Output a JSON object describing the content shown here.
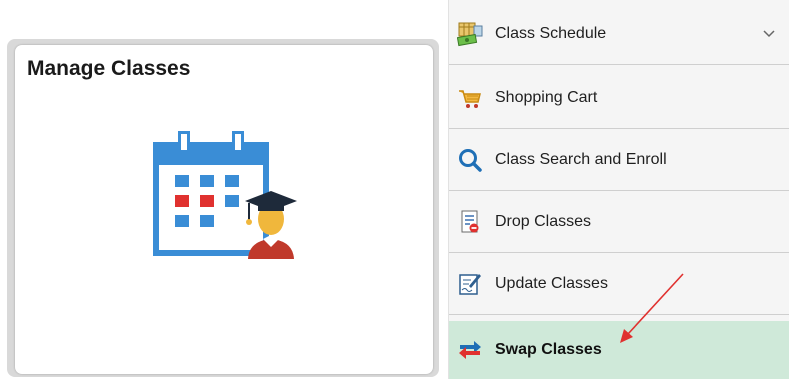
{
  "tile": {
    "title": "Manage Classes",
    "icon": "calendar-graduate-icon"
  },
  "menu": {
    "items": [
      {
        "label": "Class Schedule",
        "icon": "schedule-money-icon",
        "expanded": false
      },
      {
        "label": "Shopping Cart",
        "icon": "shopping-cart-icon"
      },
      {
        "label": "Class Search and Enroll",
        "icon": "search-icon"
      },
      {
        "label": "Drop Classes",
        "icon": "drop-document-icon"
      },
      {
        "label": "Update Classes",
        "icon": "edit-document-icon"
      },
      {
        "label": "Swap Classes",
        "icon": "swap-arrows-icon",
        "active": true
      }
    ]
  },
  "colors": {
    "active_bg": "#cfe9d9",
    "annotation_arrow": "#e0312f",
    "calendar_blue": "#3a8dd6"
  }
}
